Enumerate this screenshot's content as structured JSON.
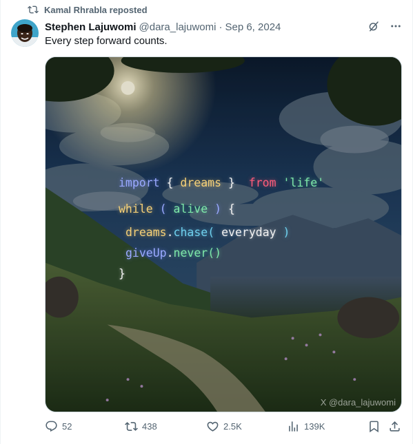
{
  "repost": {
    "text": "Kamal Rhrabla reposted"
  },
  "author": {
    "name": "Stephen Lajuwomi",
    "handle": "@dara_lajuwomi",
    "separator": "·",
    "date": "Sep 6, 2024"
  },
  "tweet": {
    "text": "Every step forward counts."
  },
  "media": {
    "code": {
      "l1": {
        "kw": "import",
        "lb": "{",
        "id": "dreams",
        "rb": "}",
        "from": "from",
        "str": "'life'"
      },
      "l2": {
        "kw": "while",
        "lp": "(",
        "id": "alive",
        "rp": ")",
        "lb": "{"
      },
      "l3": {
        "obj": "dreams",
        "dot": ".",
        "fn": "chase(",
        "arg": "everyday",
        "rp": ")"
      },
      "l4": {
        "obj": "giveUp",
        "dot": ".",
        "fn": "never()"
      },
      "l5": {
        "rb": "}"
      }
    },
    "watermark": "X @dara_lajuwomi"
  },
  "actions": {
    "replies": "52",
    "reposts": "438",
    "likes": "2.5K",
    "views": "139K"
  },
  "colors": {
    "text_secondary": "#536471",
    "text_primary": "#0f1419"
  }
}
